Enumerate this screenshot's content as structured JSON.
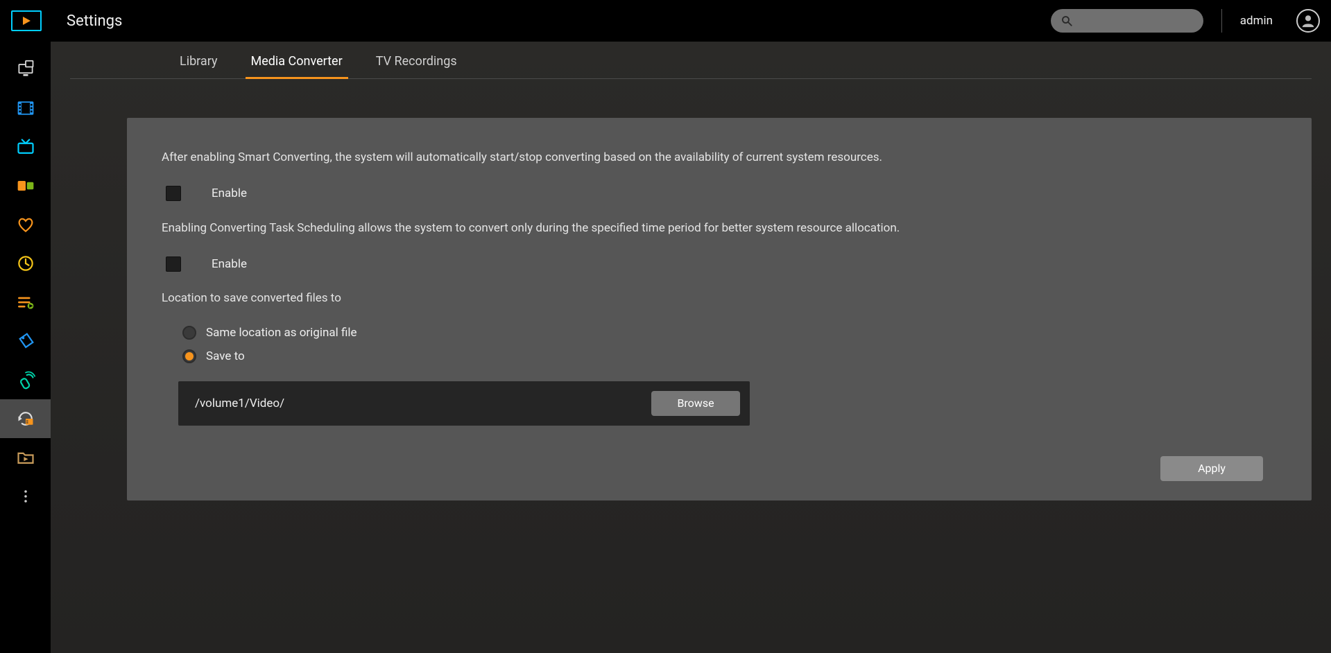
{
  "header": {
    "title": "Settings",
    "user": "admin"
  },
  "tabs": {
    "items": [
      "Library",
      "Media Converter",
      "TV Recordings"
    ],
    "active_index": 1
  },
  "panel": {
    "smart_desc": "After enabling Smart Converting, the system will automatically start/stop converting based on the availability of current system resources.",
    "enable_label_1": "Enable",
    "sched_desc": "Enabling Converting Task Scheduling allows the system to convert only during the specified time period for better system resource allocation.",
    "enable_label_2": "Enable",
    "location_label": "Location to save converted files to",
    "radio_same": "Same location as original file",
    "radio_saveto": "Save to",
    "radio_selected": 1,
    "path_value": "/volume1/Video/",
    "browse_label": "Browse",
    "apply_label": "Apply",
    "smart_checked": false,
    "sched_checked": false
  },
  "colors": {
    "accent": "#f7941d",
    "logo_border": "#00cfff"
  }
}
